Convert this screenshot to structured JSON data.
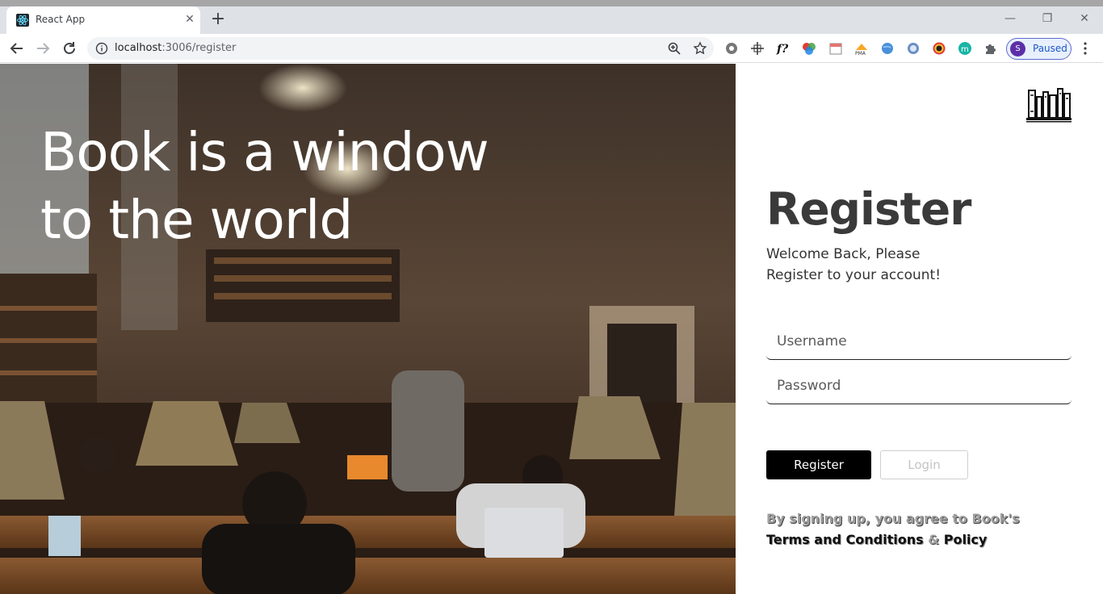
{
  "browser": {
    "tab_title": "React App",
    "tab_close": "✕",
    "new_tab": "+",
    "url_host": "localhost",
    "url_path": ":3006/register",
    "window_controls": [
      "—",
      "❐",
      "✕"
    ],
    "profile_initial": "S",
    "profile_label": "Paused",
    "extensions": [
      "settings-gear-icon",
      "move-cross-icon",
      "font-finder-icon",
      "color-picker-icon",
      "calendar-icon",
      "pma-icon",
      "globe-icon",
      "compass-icon",
      "camera-icon",
      "m-circle-icon",
      "puzzle-icon"
    ],
    "colors": {
      "tabbar": "#dee1e6",
      "omnibox": "#f1f3f4",
      "profile_accent": "#5c2fa8"
    }
  },
  "hero": {
    "heading_line1": "Book is a window",
    "heading_line2": "to the world"
  },
  "register": {
    "title": "Register",
    "subtitle_line1": "Welcome Back, Please",
    "subtitle_line2": "Register to your account!",
    "username_placeholder": "Username",
    "password_placeholder": "Password",
    "register_button": "Register",
    "login_button": "Login",
    "terms_lead": "By signing up, you agree to Book's",
    "terms_link": "Terms and Conditions",
    "terms_amp": "&",
    "policy_link": "Policy",
    "logo_icon": "bookshelf-icon"
  }
}
